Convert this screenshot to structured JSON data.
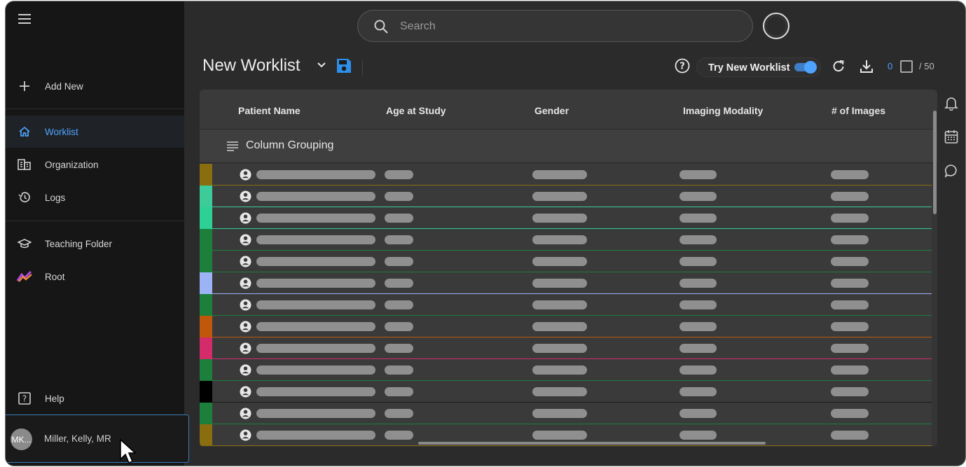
{
  "sidebar": {
    "add_new": "Add New",
    "items": [
      {
        "label": "Worklist",
        "icon": "home-icon",
        "active": true
      },
      {
        "label": "Organization",
        "icon": "organization-icon"
      },
      {
        "label": "Logs",
        "icon": "history-icon"
      },
      {
        "label": "Teaching Folder",
        "icon": "graduation-cap-icon"
      },
      {
        "label": "Root",
        "icon": "root-logo-icon"
      }
    ],
    "help": "Help"
  },
  "user": {
    "initials": "MK...",
    "name": "Miller, Kelly, MR"
  },
  "search": {
    "placeholder": "Search"
  },
  "worklist": {
    "title": "New Worklist",
    "try_new_label": "Try New Worklist",
    "try_new_enabled": true,
    "selected_count": "0",
    "total": "/ 50"
  },
  "grid": {
    "columns": [
      "Patient Name",
      "Age at Study",
      "Gender",
      "Imaging Modality",
      "# of Images"
    ],
    "grouping_label": "Column Grouping",
    "row_colors": [
      "#8a6d0f",
      "#3ecb9a",
      "#2dd196",
      "#1c7f3b",
      "#1c7f3b",
      "#9cb4f5",
      "#1c7f3b",
      "#c0580c",
      "#d42b6b",
      "#1c7f3b",
      "#000000",
      "#1c7f3b",
      "#8a6d0f"
    ]
  },
  "colors": {
    "accent": "#4ea3ff",
    "background": "#2b2b2b",
    "sidebar": "#161616"
  }
}
